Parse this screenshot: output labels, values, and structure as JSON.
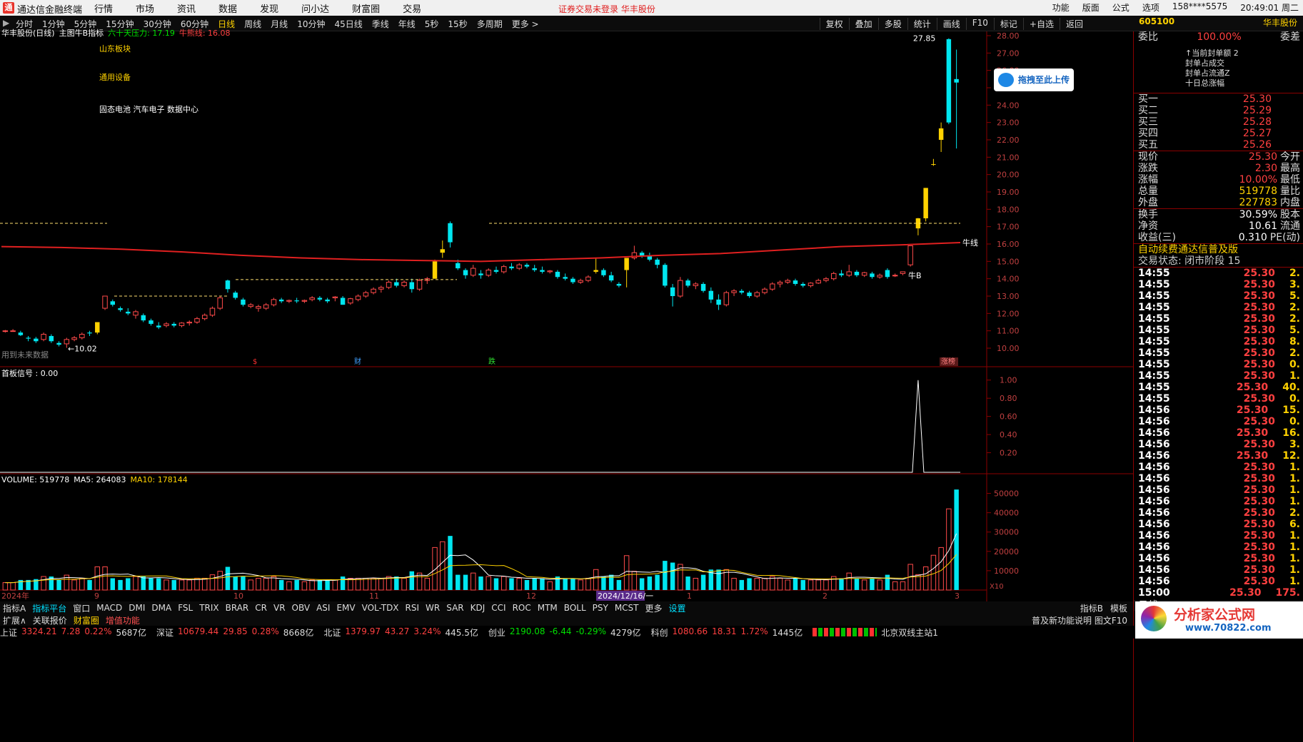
{
  "titlebar": {
    "app_name": "通达信金融终端",
    "menus": [
      "行情",
      "市场",
      "资讯",
      "数据",
      "发现",
      "问小达",
      "财富圈",
      "交易"
    ],
    "warning": "证券交易未登录  华丰股份",
    "right_items": [
      "功能",
      "版面",
      "公式",
      "选项"
    ],
    "user": "158****5575",
    "clock": "20:49:01 周二"
  },
  "periodbar": {
    "periods": [
      "分时",
      "1分钟",
      "5分钟",
      "15分钟",
      "30分钟",
      "60分钟",
      "日线",
      "周线",
      "月线",
      "10分钟",
      "45日线",
      "季线",
      "年线",
      "5秒",
      "15秒",
      "多周期",
      "更多 >"
    ],
    "active_period": "日线",
    "tools": [
      "复权",
      "叠加",
      "多股",
      "统计",
      "画线",
      "F10",
      "标记",
      "+自选",
      "返回"
    ],
    "stock_code": "605100",
    "stock_name": "华丰股份"
  },
  "main_chart": {
    "header_name": "华丰股份(日线)",
    "indicator_name": "主图牛B指标",
    "pressure_label": "六十天压力: 17.19",
    "bull_label": "牛熊线: 16.08",
    "concept_1": "山东板块",
    "concept_2": "通用设备",
    "concept_3": "固态电池 汽车电子 数据中心",
    "future_data_note": "用到未来数据",
    "high_label": "27.85",
    "low_label": "←10.02",
    "bull_line_label": "牛线",
    "bullb_label": "牛B",
    "marker_s": "$",
    "marker_cai": "财",
    "marker_die": "跌",
    "marker_zhang": "涨榜",
    "y_ticks": [
      "28.00",
      "27.00",
      "26.00",
      "25.00",
      "24.00",
      "23.00",
      "22.00",
      "21.00",
      "20.00",
      "19.00",
      "18.00",
      "17.00",
      "16.00",
      "15.00",
      "14.00",
      "13.00",
      "12.00",
      "11.00",
      "10.00"
    ]
  },
  "signal_chart": {
    "label": "首板信号 : 0.00",
    "y_ticks": [
      "1.00",
      "0.80",
      "0.60",
      "0.40",
      "0.20"
    ]
  },
  "volume_chart": {
    "label": "VOLUME: 519778",
    "ma5": "MA5: 264083",
    "ma10": "MA10: 178144",
    "y_ticks": [
      "50000",
      "40000",
      "30000",
      "20000",
      "10000",
      "X10"
    ],
    "x_labels": [
      "2024年",
      "9",
      "10",
      "11",
      "12",
      "2024/12/16/一",
      "1",
      "2",
      "3"
    ]
  },
  "quote_panel": {
    "weibi_label": "委比",
    "weibi_value": "100.00%",
    "weicha_label": "委差",
    "notes": [
      "↑当前封单额 2",
      "封单占成交 ",
      "封单占流通Z",
      "十日总涨幅"
    ],
    "bids": [
      {
        "label": "买一",
        "price": "25.30"
      },
      {
        "label": "买二",
        "price": "25.29"
      },
      {
        "label": "买三",
        "price": "25.28"
      },
      {
        "label": "买四",
        "price": "25.27"
      },
      {
        "label": "买五",
        "price": "25.26"
      }
    ],
    "stats": [
      {
        "label": "现价",
        "value": "25.30",
        "label2": "今开"
      },
      {
        "label": "涨跌",
        "value": "2.30",
        "label2": "最高"
      },
      {
        "label": "涨幅",
        "value": "10.00%",
        "label2": "最低"
      },
      {
        "label": "总量",
        "value": "519778",
        "label2": "量比"
      },
      {
        "label": "外盘",
        "value": "227783",
        "label2": "内盘"
      }
    ],
    "stats2": [
      {
        "label": "换手",
        "value": "30.59%",
        "label2": "股本"
      },
      {
        "label": "净资",
        "value": "10.61",
        "label2": "流通"
      },
      {
        "label": "收益(三)",
        "value": "0.310",
        "label2": "PE(动)"
      }
    ],
    "ad_text": "自动续费通达信普及版",
    "trade_state": "交易状态: 闭市阶段 15",
    "ticks": [
      {
        "time": "14:55",
        "price": "25.30",
        "vol": "2."
      },
      {
        "time": "14:55",
        "price": "25.30",
        "vol": "3."
      },
      {
        "time": "14:55",
        "price": "25.30",
        "vol": "5."
      },
      {
        "time": "14:55",
        "price": "25.30",
        "vol": "2."
      },
      {
        "time": "14:55",
        "price": "25.30",
        "vol": "2."
      },
      {
        "time": "14:55",
        "price": "25.30",
        "vol": "5."
      },
      {
        "time": "14:55",
        "price": "25.30",
        "vol": "8."
      },
      {
        "time": "14:55",
        "price": "25.30",
        "vol": "2."
      },
      {
        "time": "14:55",
        "price": "25.30",
        "vol": "0."
      },
      {
        "time": "14:55",
        "price": "25.30",
        "vol": "1."
      },
      {
        "time": "14:55",
        "price": "25.30",
        "vol": "40."
      },
      {
        "time": "14:55",
        "price": "25.30",
        "vol": "0."
      },
      {
        "time": "14:56",
        "price": "25.30",
        "vol": "15."
      },
      {
        "time": "14:56",
        "price": "25.30",
        "vol": "0."
      },
      {
        "time": "14:56",
        "price": "25.30",
        "vol": "16."
      },
      {
        "time": "14:56",
        "price": "25.30",
        "vol": "3."
      },
      {
        "time": "14:56",
        "price": "25.30",
        "vol": "12."
      },
      {
        "time": "14:56",
        "price": "25.30",
        "vol": "1."
      },
      {
        "time": "14:56",
        "price": "25.30",
        "vol": "1."
      },
      {
        "time": "14:56",
        "price": "25.30",
        "vol": "1."
      },
      {
        "time": "14:56",
        "price": "25.30",
        "vol": "1."
      },
      {
        "time": "14:56",
        "price": "25.30",
        "vol": "2."
      },
      {
        "time": "14:56",
        "price": "25.30",
        "vol": "6."
      },
      {
        "time": "14:56",
        "price": "25.30",
        "vol": "1."
      },
      {
        "time": "14:56",
        "price": "25.30",
        "vol": "1."
      },
      {
        "time": "14:56",
        "price": "25.30",
        "vol": "1."
      },
      {
        "time": "14:56",
        "price": "25.30",
        "vol": "1."
      },
      {
        "time": "14:56",
        "price": "25.30",
        "vol": "1."
      },
      {
        "time": "15:00",
        "price": "25.30",
        "vol": "175."
      }
    ],
    "period_tab": "日线"
  },
  "bottom_tabs": {
    "row1": [
      "指标A",
      "指标平台",
      "窗口",
      "MACD",
      "DMI",
      "DMA",
      "FSL",
      "TRIX",
      "BRAR",
      "CR",
      "VR",
      "OBV",
      "ASI",
      "EMV",
      "VOL-TDX",
      "RSI",
      "WR",
      "SAR",
      "KDJ",
      "CCI",
      "ROC",
      "MTM",
      "BOLL",
      "PSY",
      "MCST",
      "更多",
      "设置"
    ],
    "row1_right": [
      "指标B",
      "模板"
    ],
    "row2": [
      "扩展∧",
      "关联报价",
      "财富圈",
      "增值功能"
    ],
    "row2_right": "普及新功能说明 图文F10"
  },
  "statusbar": [
    {
      "name": "上证",
      "value": "3324.21",
      "chg": "7.28",
      "pct": "0.22%",
      "amt": "5687亿"
    },
    {
      "name": "深证",
      "value": "10679.44",
      "chg": "29.85",
      "pct": "0.28%",
      "amt": "8668亿"
    },
    {
      "name": "北证",
      "value": "1379.97",
      "chg": "43.27",
      "pct": "3.24%",
      "amt": "445.5亿"
    },
    {
      "name": "创业",
      "value": "2190.08",
      "chg": "-6.44",
      "pct": "-0.29%",
      "amt": "4279亿"
    },
    {
      "name": "科创",
      "value": "1080.66",
      "chg": "18.31",
      "pct": "1.72%",
      "amt": "1445亿"
    }
  ],
  "station": "北京双线主站1",
  "watermark": {
    "line1": "分析家公式网",
    "line2": "www.70822.com"
  },
  "chart_data": {
    "type": "candlestick",
    "series_note": "daily K-line with bull-bear line, signal spike and volume",
    "ohlc": [
      [
        11.0,
        11.05,
        10.9,
        11.0
      ],
      [
        11.0,
        11.1,
        10.95,
        11.0
      ],
      [
        10.9,
        11.0,
        10.7,
        10.75
      ],
      [
        10.6,
        10.7,
        10.4,
        10.55
      ],
      [
        10.55,
        10.65,
        10.3,
        10.4
      ],
      [
        10.5,
        10.9,
        10.4,
        10.8
      ],
      [
        10.7,
        10.8,
        10.3,
        10.4
      ],
      [
        10.3,
        10.4,
        10.1,
        10.2
      ],
      [
        10.25,
        10.6,
        10.02,
        10.5
      ],
      [
        10.5,
        10.7,
        10.4,
        10.6
      ],
      [
        10.6,
        10.9,
        10.5,
        10.8
      ],
      [
        10.9,
        11.0,
        10.7,
        10.85
      ],
      [
        10.9,
        11.5,
        10.8,
        11.5
      ],
      [
        12.3,
        13.0,
        12.2,
        13.0
      ],
      [
        12.7,
        12.8,
        12.4,
        12.5
      ],
      [
        12.3,
        12.4,
        12.1,
        12.2
      ],
      [
        12.1,
        12.3,
        11.9,
        12.0
      ],
      [
        11.9,
        12.2,
        11.7,
        12.1
      ],
      [
        11.9,
        12.0,
        11.5,
        11.6
      ],
      [
        11.6,
        11.7,
        11.3,
        11.4
      ],
      [
        11.3,
        11.5,
        11.1,
        11.2
      ],
      [
        11.3,
        11.5,
        11.2,
        11.4
      ],
      [
        11.4,
        11.5,
        11.2,
        11.3
      ],
      [
        11.3,
        11.5,
        11.2,
        11.45
      ],
      [
        11.45,
        11.6,
        11.3,
        11.5
      ],
      [
        11.5,
        11.8,
        11.4,
        11.7
      ],
      [
        11.7,
        12.0,
        11.6,
        11.9
      ],
      [
        11.9,
        12.4,
        11.8,
        12.3
      ],
      [
        12.3,
        13.0,
        12.2,
        12.9
      ],
      [
        13.9,
        13.95,
        13.2,
        13.4
      ],
      [
        13.2,
        13.3,
        12.8,
        12.9
      ],
      [
        12.8,
        12.9,
        12.4,
        12.5
      ],
      [
        12.4,
        12.6,
        12.3,
        12.5
      ],
      [
        12.3,
        12.5,
        12.1,
        12.4
      ],
      [
        12.3,
        12.6,
        12.2,
        12.5
      ],
      [
        12.5,
        12.9,
        12.4,
        12.8
      ],
      [
        12.8,
        12.9,
        12.6,
        12.7
      ],
      [
        12.7,
        12.8,
        12.6,
        12.75
      ],
      [
        12.75,
        12.9,
        12.6,
        12.7
      ],
      [
        12.7,
        12.8,
        12.6,
        12.75
      ],
      [
        12.8,
        13.0,
        12.7,
        12.9
      ],
      [
        12.9,
        13.0,
        12.7,
        12.8
      ],
      [
        12.8,
        12.9,
        12.6,
        12.7
      ],
      [
        12.9,
        13.0,
        12.7,
        12.95
      ],
      [
        12.9,
        13.0,
        12.5,
        12.5
      ],
      [
        12.6,
        12.9,
        12.5,
        12.85
      ],
      [
        12.8,
        13.1,
        12.7,
        13.0
      ],
      [
        13.0,
        13.3,
        12.9,
        13.2
      ],
      [
        13.2,
        13.5,
        13.1,
        13.4
      ],
      [
        13.4,
        13.6,
        13.2,
        13.5
      ],
      [
        13.5,
        13.9,
        13.4,
        13.8
      ],
      [
        13.8,
        14.0,
        13.5,
        13.6
      ],
      [
        13.6,
        13.9,
        13.5,
        13.8
      ],
      [
        13.8,
        14.0,
        13.2,
        13.4
      ],
      [
        13.4,
        14.0,
        13.3,
        13.9
      ],
      [
        13.9,
        14.1,
        13.7,
        14.0
      ],
      [
        14.0,
        15.1,
        14.0,
        15.0
      ],
      [
        15.5,
        16.2,
        15.2,
        15.7
      ],
      [
        17.2,
        17.3,
        15.8,
        16.1
      ],
      [
        14.9,
        15.1,
        14.5,
        14.6
      ],
      [
        14.5,
        14.6,
        14.0,
        14.2
      ],
      [
        14.2,
        14.8,
        14.1,
        14.6
      ],
      [
        14.3,
        14.5,
        14.0,
        14.2
      ],
      [
        14.2,
        14.6,
        14.1,
        14.5
      ],
      [
        14.5,
        14.7,
        14.3,
        14.4
      ],
      [
        14.4,
        14.8,
        14.3,
        14.7
      ],
      [
        14.7,
        14.9,
        14.5,
        14.6
      ],
      [
        14.6,
        14.9,
        14.5,
        14.8
      ],
      [
        14.8,
        14.9,
        14.6,
        14.7
      ],
      [
        14.6,
        14.8,
        14.4,
        14.5
      ],
      [
        14.5,
        14.7,
        14.3,
        14.4
      ],
      [
        14.4,
        14.5,
        14.3,
        14.45
      ],
      [
        14.4,
        14.5,
        14.0,
        14.1
      ],
      [
        14.1,
        14.3,
        13.9,
        14.0
      ],
      [
        14.0,
        14.1,
        13.7,
        13.8
      ],
      [
        13.8,
        14.0,
        13.7,
        13.9
      ],
      [
        13.9,
        14.2,
        13.8,
        14.1
      ],
      [
        14.4,
        15.2,
        14.3,
        14.5
      ],
      [
        14.5,
        14.6,
        14.1,
        14.2
      ],
      [
        14.2,
        14.4,
        13.8,
        13.9
      ],
      [
        13.7,
        13.8,
        13.5,
        13.6
      ],
      [
        14.5,
        15.2,
        13.5,
        15.2
      ],
      [
        15.2,
        15.9,
        15.1,
        15.5
      ],
      [
        15.5,
        15.6,
        15.2,
        15.3
      ],
      [
        15.3,
        15.5,
        15.0,
        15.1
      ],
      [
        15.1,
        15.2,
        14.6,
        14.8
      ],
      [
        14.8,
        14.9,
        13.5,
        13.6
      ],
      [
        13.5,
        13.7,
        12.4,
        13.0
      ],
      [
        13.0,
        14.1,
        12.9,
        13.9
      ],
      [
        13.9,
        14.0,
        13.5,
        13.6
      ],
      [
        13.6,
        13.8,
        13.4,
        13.7
      ],
      [
        13.7,
        13.8,
        13.2,
        13.3
      ],
      [
        13.3,
        13.5,
        12.6,
        12.8
      ],
      [
        12.8,
        13.1,
        12.2,
        12.5
      ],
      [
        12.5,
        13.3,
        12.4,
        13.2
      ],
      [
        13.2,
        13.4,
        13.0,
        13.3
      ],
      [
        13.3,
        13.4,
        13.1,
        13.2
      ],
      [
        13.2,
        13.3,
        12.9,
        13.0
      ],
      [
        13.0,
        13.3,
        12.9,
        13.2
      ],
      [
        13.2,
        13.5,
        13.1,
        13.4
      ],
      [
        13.4,
        13.8,
        13.3,
        13.7
      ],
      [
        13.7,
        13.9,
        13.5,
        13.8
      ],
      [
        13.8,
        14.0,
        13.7,
        13.9
      ],
      [
        13.9,
        14.0,
        13.6,
        13.7
      ],
      [
        13.7,
        13.8,
        13.5,
        13.6
      ],
      [
        13.6,
        13.8,
        13.5,
        13.75
      ],
      [
        13.75,
        14.0,
        13.7,
        13.9
      ],
      [
        13.9,
        14.1,
        13.8,
        14.0
      ],
      [
        14.0,
        14.4,
        13.9,
        14.3
      ],
      [
        14.3,
        14.5,
        14.1,
        14.2
      ],
      [
        14.2,
        14.8,
        14.1,
        14.4
      ],
      [
        14.4,
        14.5,
        14.1,
        14.2
      ],
      [
        14.2,
        14.4,
        14.1,
        14.35
      ],
      [
        14.3,
        14.4,
        14.0,
        14.1
      ],
      [
        14.1,
        14.3,
        14.0,
        14.2
      ],
      [
        14.5,
        14.6,
        14.0,
        14.1
      ],
      [
        14.2,
        14.3,
        14.1,
        14.2
      ],
      [
        14.3,
        14.4,
        14.2,
        14.4
      ],
      [
        14.8,
        15.9,
        14.7,
        15.9
      ],
      [
        16.9,
        17.5,
        16.5,
        17.48
      ],
      [
        17.48,
        19.23,
        17.3,
        19.23
      ],
      [
        20.6,
        20.9,
        20.5,
        20.6
      ],
      [
        22.0,
        23.0,
        21.3,
        22.66
      ],
      [
        23.0,
        27.85,
        22.9,
        27.8
      ],
      [
        25.5,
        27.2,
        21.5,
        25.3
      ]
    ],
    "bull_bear_line": [
      15.85,
      15.8,
      15.7,
      15.55,
      15.35,
      15.2,
      15.1,
      15.05,
      15.0,
      15.1,
      15.2,
      15.35,
      15.45,
      15.65,
      15.85,
      15.95,
      16.08
    ],
    "pressure_60d": 17.19,
    "signal_spike_value": 1.0,
    "volume_ma_note": "MA5/MA10 overlaid",
    "y_range": [
      10,
      28
    ],
    "volume_range": [
      0,
      55000
    ],
    "signal_range": [
      0,
      1.1
    ]
  }
}
